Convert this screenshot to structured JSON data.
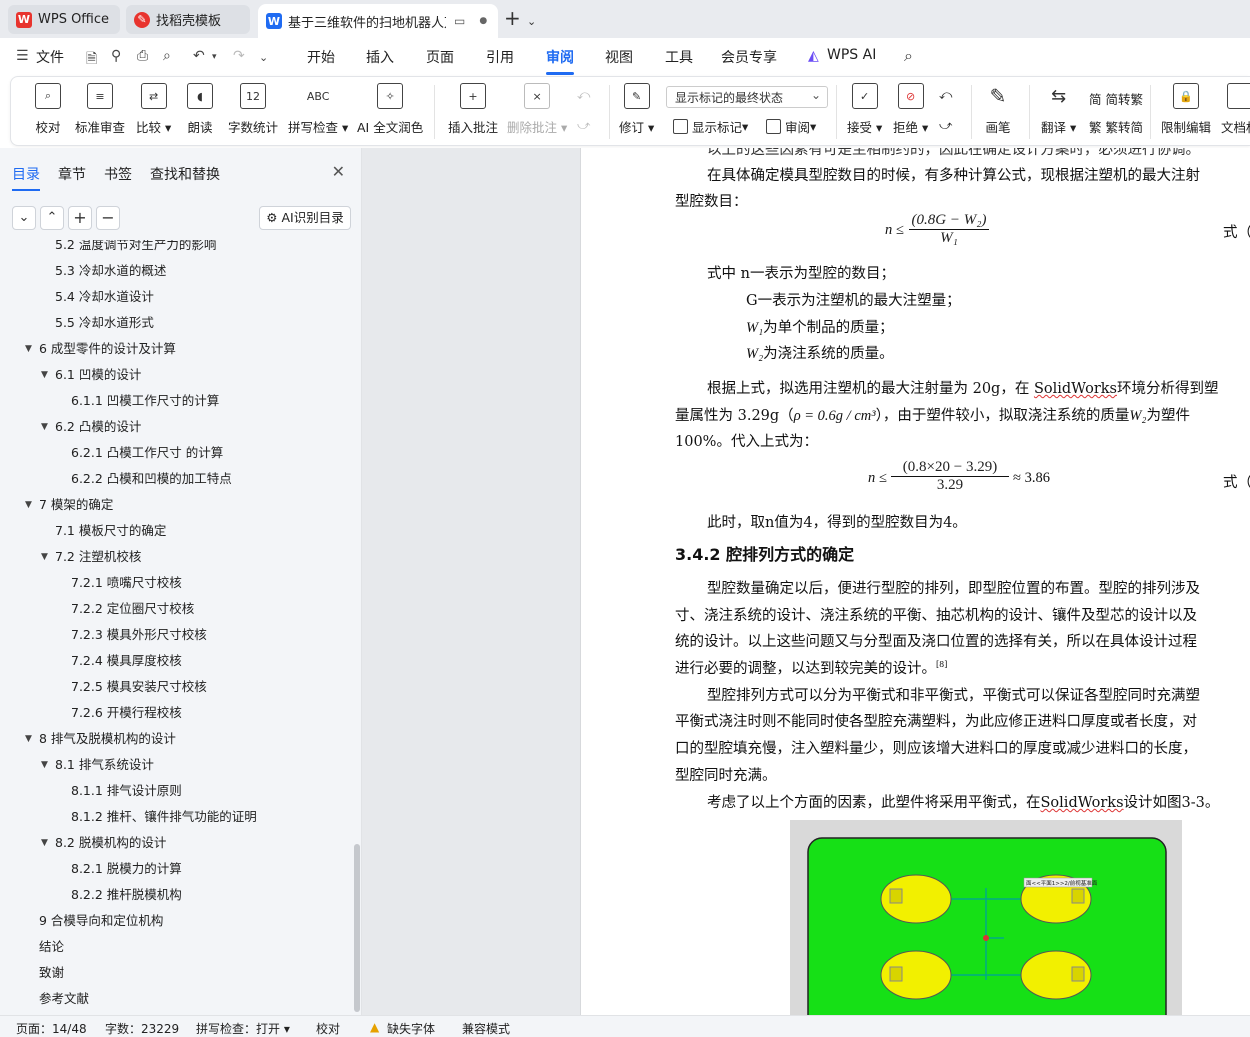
{
  "tabs": [
    {
      "label": "WPS Office",
      "icon": "wps-logo-icon",
      "color": "#e8342e"
    },
    {
      "label": "找稻壳模板",
      "icon": "docer-icon",
      "color": "#e8342e"
    },
    {
      "label": "基于三维软件的扫地机器人万",
      "icon": "word-doc-icon",
      "color": "#1f6bf2"
    }
  ],
  "menu": {
    "file": "文件",
    "items": [
      "开始",
      "插入",
      "页面",
      "引用",
      "审阅",
      "视图",
      "工具",
      "会员专享"
    ],
    "active": "审阅",
    "wps_ai": "WPS AI"
  },
  "ribbon": {
    "proofread": "校对",
    "std_review": "标准审查",
    "compare": "比较",
    "read_aloud": "朗读",
    "word_count": "字数统计",
    "spell_check": "拼写检查",
    "ai_polish": "AI 全文润色",
    "insert_comment": "插入批注",
    "delete_comment": "删除批注",
    "track": "修订",
    "markup_select": "显示标记的最终状态",
    "show_markup": "显示标记",
    "review": "审阅",
    "accept": "接受",
    "reject": "拒绝",
    "pen": "画笔",
    "translate": "翻译",
    "to_trad": "繁转简",
    "to_trad_label": "简转繁",
    "trad_to_simp": "繁转简",
    "restrict": "限制编辑",
    "doc_right": "文档权"
  },
  "nav": {
    "tabs": [
      "目录",
      "章节",
      "书签",
      "查找和替换"
    ],
    "active_tab": "目录",
    "ai_button": "AI识别目录",
    "toc": [
      {
        "text": "5.2  温度调节对生产力的影响",
        "level": 2,
        "arrow": false
      },
      {
        "text": "5.3  冷却水道的概述",
        "level": 2,
        "arrow": false
      },
      {
        "text": "5.4  冷却水道设计",
        "level": 2,
        "arrow": false
      },
      {
        "text": "5.5  冷却水道形式",
        "level": 2,
        "arrow": false
      },
      {
        "text": "6  成型零件的设计及计算",
        "level": 1,
        "arrow": true
      },
      {
        "text": "6.1  凹模的设计",
        "level": 2,
        "arrow": true
      },
      {
        "text": "6.1.1  凹模工作尺寸的计算",
        "level": 3,
        "arrow": false
      },
      {
        "text": "6.2  凸模的设计",
        "level": 2,
        "arrow": true
      },
      {
        "text": "6.2.1  凸模工作尺寸 的计算",
        "level": 3,
        "arrow": false
      },
      {
        "text": "6.2.2  凸模和凹模的加工特点",
        "level": 3,
        "arrow": false
      },
      {
        "text": "7  模架的确定",
        "level": 1,
        "arrow": true
      },
      {
        "text": "7.1  模板尺寸的确定",
        "level": 2,
        "arrow": false
      },
      {
        "text": "7.2  注塑机校核",
        "level": 2,
        "arrow": true
      },
      {
        "text": "7.2.1  喷嘴尺寸校核",
        "level": 3,
        "arrow": false
      },
      {
        "text": "7.2.2  定位圈尺寸校核",
        "level": 3,
        "arrow": false
      },
      {
        "text": "7.2.3  模具外形尺寸校核",
        "level": 3,
        "arrow": false
      },
      {
        "text": "7.2.4  模具厚度校核",
        "level": 3,
        "arrow": false
      },
      {
        "text": "7.2.5  模具安装尺寸校核",
        "level": 3,
        "arrow": false
      },
      {
        "text": "7.2.6  开模行程校核",
        "level": 3,
        "arrow": false
      },
      {
        "text": "8  排气及脱模机构的设计",
        "level": 1,
        "arrow": true
      },
      {
        "text": "8.1  排气系统设计",
        "level": 2,
        "arrow": true
      },
      {
        "text": "8.1.1  排气设计原则",
        "level": 3,
        "arrow": false
      },
      {
        "text": "8.1.2  推杆、镶件排气功能的证明",
        "level": 3,
        "arrow": false
      },
      {
        "text": "8.2  脱模机构的设计",
        "level": 2,
        "arrow": true
      },
      {
        "text": "8.2.1  脱模力的计算",
        "level": 3,
        "arrow": false
      },
      {
        "text": "8.2.2  推杆脱模机构",
        "level": 3,
        "arrow": false
      },
      {
        "text": "9  合模导向和定位机构",
        "level": 1,
        "arrow": false
      },
      {
        "text": "结论",
        "level": 1,
        "arrow": false
      },
      {
        "text": "致谢",
        "level": 1,
        "arrow": false
      },
      {
        "text": "参考文献",
        "level": 1,
        "arrow": false
      }
    ]
  },
  "doc": {
    "line0": "以上的这些因素有可是至相制约的，因此在确定设计方案时，必须进行协调。",
    "p1a": "在具体确定模具型腔数目的时候，有多种计算公式，现根据注塑机的最大注射",
    "p1b": "型腔数目：",
    "eq1_num": "(0.8G − W₂)",
    "eq1_den": "W₁",
    "eq1_lhs": "n ≤",
    "eq1_tag": "式（",
    "where1": "式中  n一表示为型腔的数目；",
    "where2": "G一表示为注塑机的最大注塑量；",
    "where3": "为单个制品的质量；",
    "where3_sym": "W₁",
    "where4": "为浇注系统的质量。",
    "where4_sym": "W₂",
    "p2a_1": "根据上式，拟选用注塑机的最大注射量为 20g，在 ",
    "p2a_sw": "SolidWorks",
    "p2a_2": "环境分析得到塑",
    "p2b_1": "量属性为 3.29g（",
    "p2b_rho": "ρ = 0.6g / cm³",
    "p2b_2": "），由于塑件较小，拟取浇注系统的质量",
    "p2b_sym": "W₂",
    "p2b_3": "为塑件",
    "p2c": "100%。代入上式为：",
    "eq2_lhs": "n ≤",
    "eq2_num": "(0.8×20 − 3.29)",
    "eq2_den": "3.29",
    "eq2_rhs": "≈ 3.86",
    "eq2_tag": "式（",
    "p3": "此时，取n值为4，得到的型腔数目为4。",
    "h342": "3.4.2  腔排列方式的确定",
    "p4a": "型腔数量确定以后，便进行型腔的排列，即型腔位置的布置。型腔的排列涉及",
    "p4b": "寸、浇注系统的设计、浇注系统的平衡、抽芯机构的设计、镶件及型芯的设计以及",
    "p4c": "统的设计。以上这些问题又与分型面及浇口位置的选择有关，所以在具体设计过程",
    "p4d": "进行必要的调整，以达到较完美的设计。",
    "p4d_ref": "[8]",
    "p5a": "型腔排列方式可以分为平衡式和非平衡式，平衡式可以保证各型腔同时充满塑",
    "p5b": "平衡式浇注时则不能同时使各型腔充满塑料，为此应修正进料口厚度或者长度，对",
    "p5c": "口的型腔填充慢，注入塑料量少，则应该增大进料口的厚度或减少进料口的长度，",
    "p5d": "型腔同时充满。",
    "p6_1": "考虑了以上个方面的因素，此塑件将采用平衡式，在",
    "p6_sw": "SolidWorks",
    "p6_2": "设计如图3-3。",
    "figure_tag": "面<<平面1>>2/前视基准面"
  },
  "status": {
    "page": "页面：14/48",
    "words": "字数：23229",
    "spell": "拼写检查：打开",
    "proof": "校对",
    "missing_font": "缺失字体",
    "compat": "兼容模式"
  },
  "colors": {
    "accent": "#1f6bf2",
    "wps_red": "#e8342e",
    "mold_green": "#16e016",
    "cavity_yellow": "#f2f000"
  }
}
